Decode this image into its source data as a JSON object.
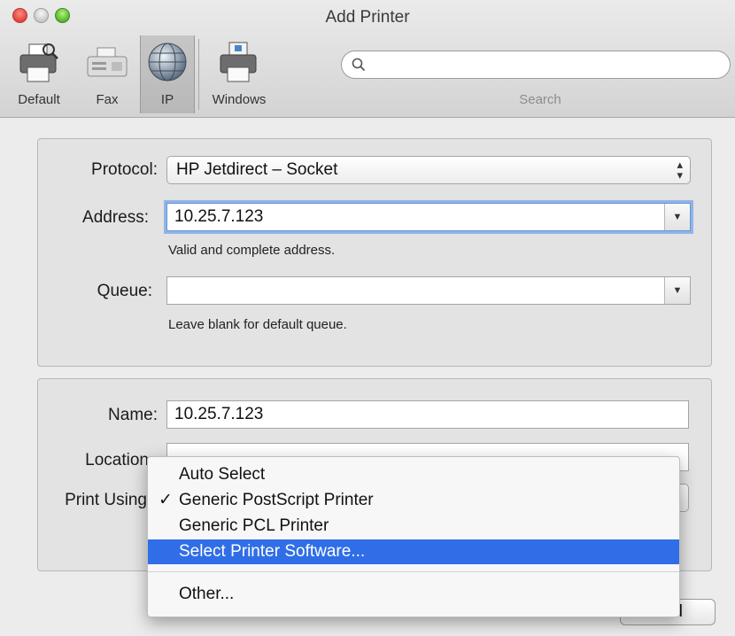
{
  "window": {
    "title": "Add Printer"
  },
  "toolbar": {
    "items": [
      {
        "label": "Default",
        "icon": "default-printer-icon"
      },
      {
        "label": "Fax",
        "icon": "fax-icon"
      },
      {
        "label": "IP",
        "icon": "globe-icon",
        "selected": true
      },
      {
        "label": "Windows",
        "icon": "windows-printer-icon"
      }
    ],
    "search": {
      "value": "",
      "placeholder": "",
      "label": "Search"
    }
  },
  "connection": {
    "protocol_label": "Protocol:",
    "protocol_value": "HP Jetdirect – Socket",
    "address_label": "Address:",
    "address_value": "10.25.7.123",
    "address_hint": "Valid and complete address.",
    "queue_label": "Queue:",
    "queue_value": "",
    "queue_hint": "Leave blank for default queue."
  },
  "printer_info": {
    "name_label": "Name:",
    "name_value": "10.25.7.123",
    "location_label": "Location",
    "location_value": "",
    "print_using_label": "Print Using"
  },
  "print_using_menu": {
    "items": [
      {
        "label": "Auto Select",
        "checked": false,
        "highlighted": false
      },
      {
        "label": "Generic PostScript Printer",
        "checked": true,
        "highlighted": false
      },
      {
        "label": "Generic PCL Printer",
        "checked": false,
        "highlighted": false
      },
      {
        "label": "Select Printer Software...",
        "checked": false,
        "highlighted": true
      },
      {
        "label": "Other...",
        "checked": false,
        "highlighted": false
      }
    ],
    "check_glyph": "✓"
  },
  "buttons": {
    "add_label": "Add"
  },
  "colors": {
    "menu_highlight": "#2f6ee6",
    "focus_ring": "#8fb4e8"
  }
}
